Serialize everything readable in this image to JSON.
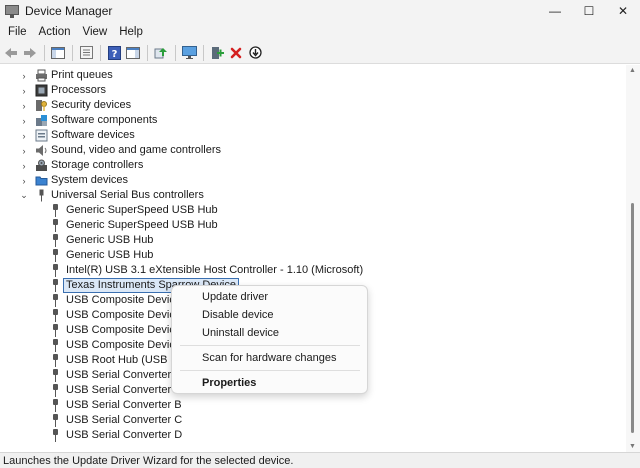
{
  "window": {
    "title": "Device Manager",
    "controls": {
      "minimize": "—",
      "maximize": "☐",
      "close": "✕"
    }
  },
  "menu": [
    "File",
    "Action",
    "View",
    "Help"
  ],
  "toolbar": {
    "icons": [
      "back-arrow-icon",
      "forward-arrow-icon",
      "show-hide-console-tree-icon",
      "properties-icon",
      "help-icon",
      "action-pane-icon",
      "update-driver-icon",
      "scan-hardware-icon",
      "add-driver-icon",
      "uninstall-icon",
      "disable-icon"
    ]
  },
  "colors": {
    "selection_border": "#3a6fb0",
    "selection_fill": "#dbe8f7",
    "uninstall_red": "#d42020",
    "add_green": "#2a9d3a"
  },
  "tree": {
    "categories": [
      {
        "label": "Print queues",
        "icon": "printer-icon",
        "expanded": false
      },
      {
        "label": "Processors",
        "icon": "processor-icon",
        "expanded": false
      },
      {
        "label": "Security devices",
        "icon": "security-key-icon",
        "expanded": false
      },
      {
        "label": "Software components",
        "icon": "puzzle-icon",
        "expanded": false
      },
      {
        "label": "Software devices",
        "icon": "software-device-icon",
        "expanded": false
      },
      {
        "label": "Sound, video and game controllers",
        "icon": "speaker-icon",
        "expanded": false
      },
      {
        "label": "Storage controllers",
        "icon": "storage-gear-icon",
        "expanded": false
      },
      {
        "label": "System devices",
        "icon": "folder-icon",
        "expanded": false
      },
      {
        "label": "Universal Serial Bus controllers",
        "icon": "usb-icon",
        "expanded": true
      }
    ],
    "usb_children": [
      "Generic SuperSpeed USB Hub",
      "Generic SuperSpeed USB Hub",
      "Generic USB Hub",
      "Generic USB Hub",
      "Intel(R) USB 3.1 eXtensible Host Controller - 1.10 (Microsoft)",
      "Texas Instruments Sparrow Device",
      "USB Composite Device",
      "USB Composite Device",
      "USB Composite Device",
      "USB Composite Device",
      "USB Root Hub (USB 3.0)",
      "USB Serial Converter",
      "USB Serial Converter A",
      "USB Serial Converter B",
      "USB Serial Converter C",
      "USB Serial Converter D"
    ],
    "selected_index": 5
  },
  "context_menu": {
    "items": [
      "Update driver",
      "Disable device",
      "Uninstall device",
      "Scan for hardware changes",
      "Properties"
    ]
  },
  "status": "Launches the Update Driver Wizard for the selected device."
}
